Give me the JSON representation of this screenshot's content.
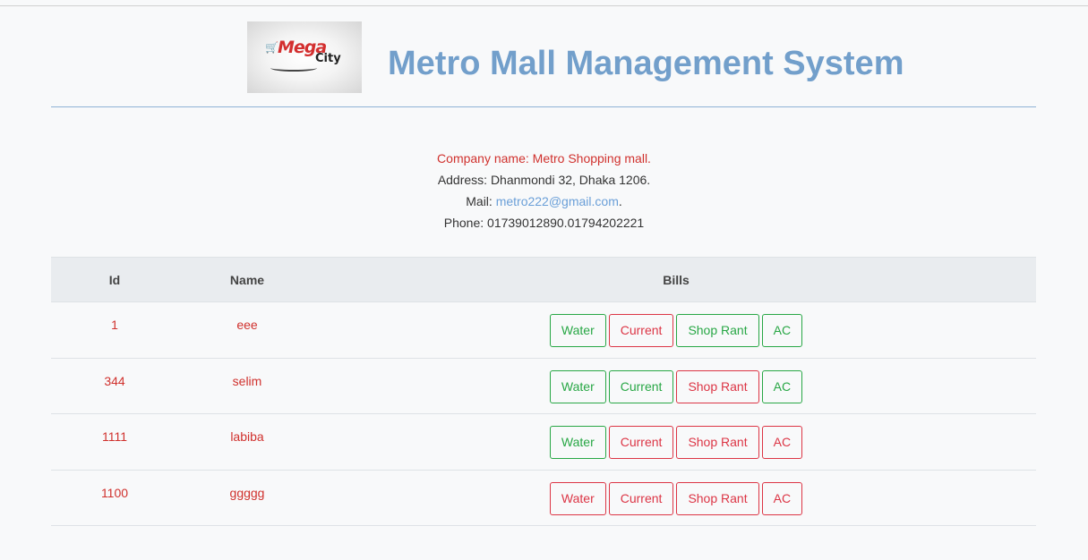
{
  "header": {
    "logo_main": "Mega",
    "logo_sub": "City",
    "title": "Metro Mall Management System"
  },
  "company": {
    "name_line": "Company name: Metro Shopping mall.",
    "address_line": "Address: Dhanmondi 32, Dhaka 1206.",
    "mail_label": "Mail: ",
    "mail_value": "metro222@gmail.com",
    "mail_suffix": ".",
    "phone_line": "Phone: 01739012890.01794202221"
  },
  "table": {
    "headers": [
      "Id",
      "Name",
      "Bills"
    ],
    "bill_labels": [
      "Water",
      "Current",
      "Shop Rant",
      "AC"
    ],
    "rows": [
      {
        "id": "1",
        "name": "eee",
        "bill_status": [
          "green",
          "red",
          "green",
          "green"
        ]
      },
      {
        "id": "344",
        "name": "selim",
        "bill_status": [
          "green",
          "green",
          "red",
          "green"
        ]
      },
      {
        "id": "1111",
        "name": "labiba",
        "bill_status": [
          "green",
          "red",
          "red",
          "red"
        ]
      },
      {
        "id": "1100",
        "name": "ggggg",
        "bill_status": [
          "red",
          "red",
          "red",
          "red"
        ]
      }
    ]
  },
  "colors": {
    "title": "#729fcb",
    "accent_red": "#d0312d",
    "paid_green": "#28a745",
    "unpaid_red": "#dc3545",
    "link": "#6a9fd8"
  },
  "icons": {
    "logo_cart": "shopping-cart-icon"
  }
}
